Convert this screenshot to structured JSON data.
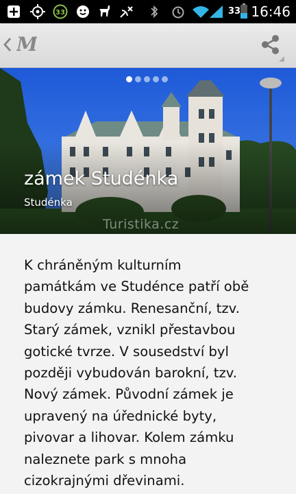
{
  "status_bar": {
    "time": "16:46",
    "battery_level": "33",
    "notification_count": "33",
    "icons": [
      "add-box-icon",
      "gps-icon",
      "notification-count-icon",
      "smiley-icon",
      "llama-icon",
      "satellite-icon",
      "bluetooth-icon",
      "alarm-icon",
      "wifi-icon",
      "signal-icon",
      "battery-icon"
    ]
  },
  "action_bar": {
    "logo_text": "M",
    "icons": [
      "back-chevron-icon",
      "app-logo-icon",
      "share-icon"
    ]
  },
  "hero": {
    "title": "zámek Studénka",
    "subtitle": "Studénka",
    "watermark": "Turistika.cz",
    "carousel_pages": 5,
    "carousel_active_index": 0
  },
  "article": {
    "lines": [
      "K chráněným kulturním",
      "památkám ve Studénce patří obě",
      "budovy zámku. Renesanční, tzv.",
      "Starý zámek, vznikl přestavbou",
      "gotické tvrze. V sousedství byl",
      "později vybudován barokní, tzv.",
      "Nový zámek. Původní zámek je",
      "upravený na úřednické byty,",
      "pivovar a lihovar. Kolem zámku",
      "naleznete park s mnoha",
      "cizokrajnými dřevinami."
    ]
  },
  "colors": {
    "status_bar_bg": "#000000",
    "action_bar_bg": "#e3e3e3",
    "accent_green": "#8bc34a",
    "text": "#111111",
    "page_bg": "#f3f3f3"
  }
}
